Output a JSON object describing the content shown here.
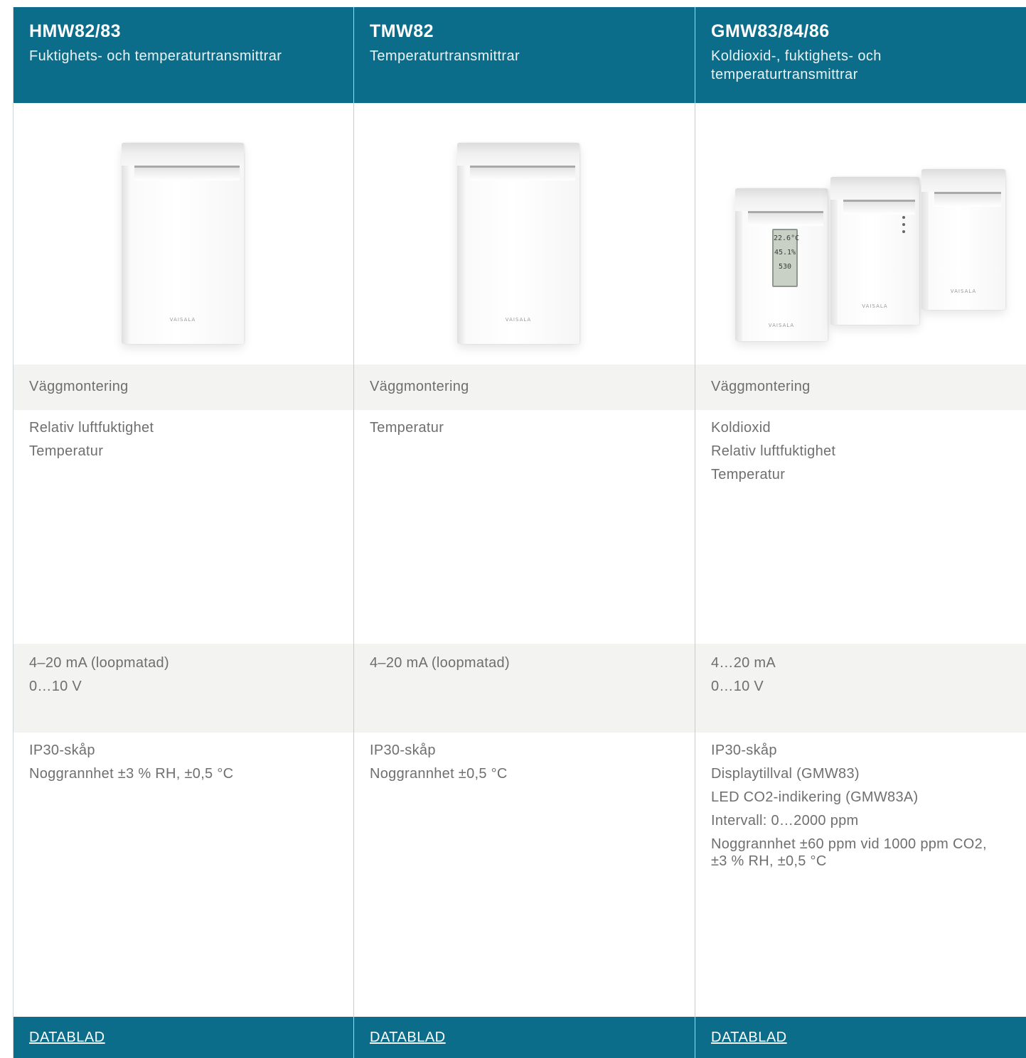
{
  "products": [
    {
      "name": "HMW82/83",
      "subtitle": "Fuktighets- och temperaturtransmittrar",
      "mounting": "Väggmontering",
      "measures": [
        "Relativ luftfuktighet",
        "Temperatur"
      ],
      "outputs": [
        "4–20 mA (loopmatad)",
        "0…10 V"
      ],
      "features": [
        "IP30-skåp",
        "Noggrannhet ±3 % RH, ±0,5 °C"
      ],
      "link": "DATABLAD",
      "brand": "VAISALA"
    },
    {
      "name": "TMW82",
      "subtitle": "Temperaturtransmittrar",
      "mounting": "Väggmontering",
      "measures": [
        "Temperatur"
      ],
      "outputs": [
        "4–20 mA (loopmatad)"
      ],
      "features": [
        "IP30-skåp",
        "Noggrannhet ±0,5 °C"
      ],
      "link": "DATABLAD",
      "brand": "VAISALA"
    },
    {
      "name": "GMW83/84/86",
      "subtitle": "Koldioxid-, fuktighets- och temperaturtransmittrar",
      "mounting": "Väggmontering",
      "measures": [
        "Koldioxid",
        "Relativ luftfuktighet",
        "Temperatur"
      ],
      "outputs": [
        "4…20 mA",
        "0…10 V"
      ],
      "features": [
        "IP30-skåp",
        "Displaytillval (GMW83)",
        "LED CO2-indikering (GMW83A)",
        "Intervall: 0…2000 ppm",
        "Noggrannhet ±60 ppm vid 1000 ppm CO2, ±3 % RH, ±0,5 °C"
      ],
      "link": "DATABLAD",
      "brand": "VAISALA",
      "display_readings": [
        "22.6°C",
        "45.1%",
        "530"
      ]
    }
  ],
  "colors": {
    "header_bg": "#0c6d8b",
    "row_alt_bg": "#f3f3f2",
    "text": "#6f6f6f"
  }
}
